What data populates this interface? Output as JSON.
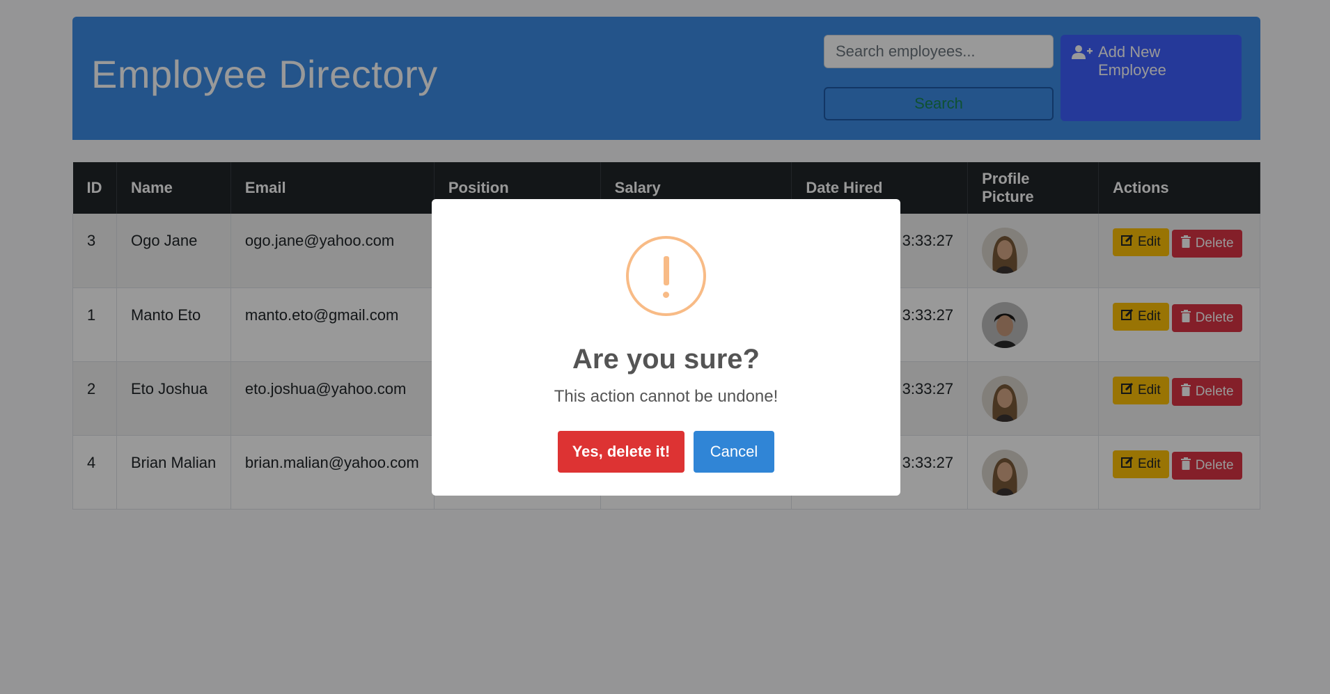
{
  "header": {
    "title": "Employee Directory",
    "search_placeholder": "Search employees...",
    "search_label": "Search",
    "add_label": "Add New Employee"
  },
  "table": {
    "columns": [
      "ID",
      "Name",
      "Email",
      "Position",
      "Salary",
      "Date Hired",
      "Profile Picture",
      "Actions"
    ],
    "rows": [
      {
        "id": "3",
        "name": "Ogo Jane",
        "email": "ogo.jane@yahoo.com",
        "date_hired": "3:33:27"
      },
      {
        "id": "1",
        "name": "Manto Eto",
        "email": "manto.eto@gmail.com",
        "date_hired": "3:33:27"
      },
      {
        "id": "2",
        "name": "Eto Joshua",
        "email": "eto.joshua@yahoo.com",
        "date_hired": "3:33:27"
      },
      {
        "id": "4",
        "name": "Brian Malian",
        "email": "brian.malian@yahoo.com",
        "date_hired": "3:33:27"
      }
    ],
    "edit_label": "Edit",
    "delete_label": "Delete"
  },
  "modal": {
    "icon": "warning-icon",
    "title": "Are you sure?",
    "text": "This action cannot be undone!",
    "confirm_label": "Yes, delete it!",
    "cancel_label": "Cancel"
  },
  "colors": {
    "header_bg": "#3c8de6",
    "add_button": "#3f5fff",
    "edit_button": "#ffc107",
    "delete_button": "#dc3545",
    "confirm_button": "#dd3333",
    "cancel_button": "#3085d6",
    "warning_icon": "#f8bb86"
  }
}
